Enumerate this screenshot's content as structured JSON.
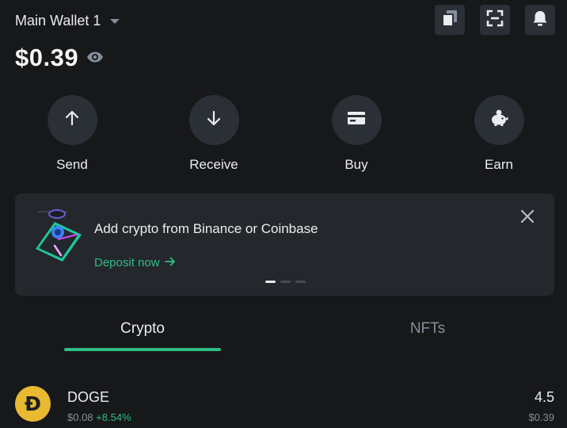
{
  "header": {
    "wallet_name": "Main Wallet 1",
    "balance": "$0.39",
    "icons": [
      "copy-icon",
      "scan-icon",
      "bell-icon"
    ]
  },
  "actions": [
    {
      "label": "Send",
      "icon": "arrow-up-icon"
    },
    {
      "label": "Receive",
      "icon": "arrow-down-icon"
    },
    {
      "label": "Buy",
      "icon": "card-icon"
    },
    {
      "label": "Earn",
      "icon": "piggy-bank-icon"
    }
  ],
  "banner": {
    "title": "Add crypto from Binance or Coinbase",
    "link_label": "Deposit now",
    "slide_count": 3,
    "active_slide": 1
  },
  "tabs": [
    {
      "label": "Crypto",
      "active": true
    },
    {
      "label": "NFTs",
      "active": false
    }
  ],
  "assets": [
    {
      "symbol": "DOGE",
      "glyph": "Ð",
      "price": "$0.08",
      "change": "+8.54%",
      "amount": "4.5",
      "value": "$0.39"
    }
  ],
  "colors": {
    "background": "#17181a",
    "surface": "#2b2f36",
    "card": "#24272c",
    "accent": "#2ebd85",
    "muted": "#848e9c",
    "doge": "#e8b931"
  }
}
